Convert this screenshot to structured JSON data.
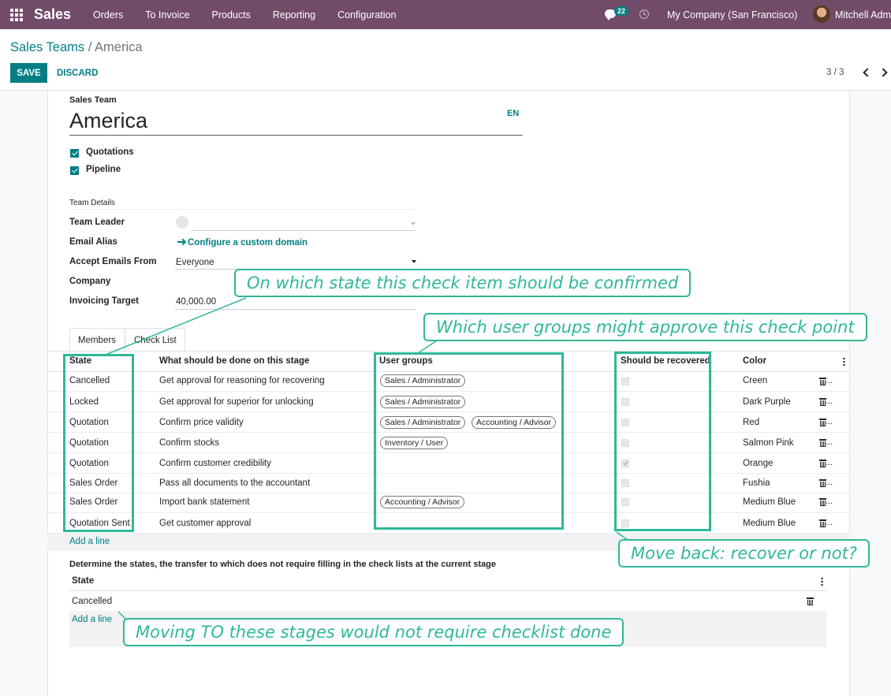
{
  "navbar": {
    "app_name": "Sales",
    "menus": [
      "Orders",
      "To Invoice",
      "Products",
      "Reporting",
      "Configuration"
    ],
    "chat_count": "22",
    "company": "My Company (San Francisco)",
    "user": "Mitchell Admin",
    "bg_color": "#714b67"
  },
  "breadcrumb": {
    "parent": "Sales Teams",
    "separator": "/",
    "current": "America"
  },
  "toolbar": {
    "save_label": "SAVE",
    "discard_label": "DISCARD",
    "pager": "3 / 3"
  },
  "form": {
    "name_label": "Sales Team",
    "name": "America",
    "lang": "EN",
    "checkboxes": [
      {
        "label": "Quotations",
        "checked": true
      },
      {
        "label": "Pipeline",
        "checked": true
      }
    ],
    "group_title": "Team Details",
    "fields": {
      "team_leader": {
        "label": "Team Leader",
        "value": ""
      },
      "email_alias": {
        "label": "Email Alias",
        "link": "Configure a custom domain"
      },
      "accept_emails": {
        "label": "Accept Emails From",
        "value": "Everyone"
      },
      "company": {
        "label": "Company",
        "value": ""
      },
      "invoicing_target": {
        "label": "Invoicing Target",
        "value": "40,000.00"
      }
    }
  },
  "tabs": [
    {
      "label": "Members",
      "active": false
    },
    {
      "label": "Check List",
      "active": true
    }
  ],
  "checklist": {
    "columns": [
      "State",
      "What should be done on this stage",
      "User groups",
      "Should be recovered",
      "Color"
    ],
    "rows": [
      {
        "state": "Cancelled",
        "task": "Get approval for reasoning for recovering",
        "groups": [
          "Sales / Administrator"
        ],
        "recovered": false,
        "color": "Creen"
      },
      {
        "state": "Locked",
        "task": "Get approval for superior for unlocking",
        "groups": [
          "Sales / Administrator"
        ],
        "recovered": false,
        "color": "Dark Purple"
      },
      {
        "state": "Quotation",
        "task": "Confirm price validity",
        "groups": [
          "Sales / Administrator",
          "Accounting / Advisor"
        ],
        "recovered": false,
        "color": "Red"
      },
      {
        "state": "Quotation",
        "task": "Confirm stocks",
        "groups": [
          "Inventory / User"
        ],
        "recovered": false,
        "color": "Salmon Pink"
      },
      {
        "state": "Quotation",
        "task": "Confirm customer credibility",
        "groups": [],
        "recovered": true,
        "color": "Orange"
      },
      {
        "state": "Sales Order",
        "task": "Pass all documents to the accountant",
        "groups": [],
        "recovered": false,
        "color": "Fushia"
      },
      {
        "state": "Sales Order",
        "task": "Import bank statement",
        "groups": [
          "Accounting / Advisor"
        ],
        "recovered": false,
        "color": "Medium Blue"
      },
      {
        "state": "Quotation Sent",
        "task": "Get customer approval",
        "groups": [],
        "recovered": false,
        "color": "Medium Blue"
      }
    ],
    "add_line": "Add a line"
  },
  "no_check_states": {
    "title": "Determine the states, the transfer to which does not require filling in the check lists at the current stage",
    "column": "State",
    "rows": [
      "Cancelled"
    ],
    "add_line": "Add a line"
  },
  "annotations": {
    "state": "On which state this check item should be confirmed",
    "groups": "Which user groups might approve this check point",
    "recovered": "Move back: recover or not?",
    "no_check": "Moving TO these stages would not require checklist done",
    "color": "#2fb899"
  }
}
